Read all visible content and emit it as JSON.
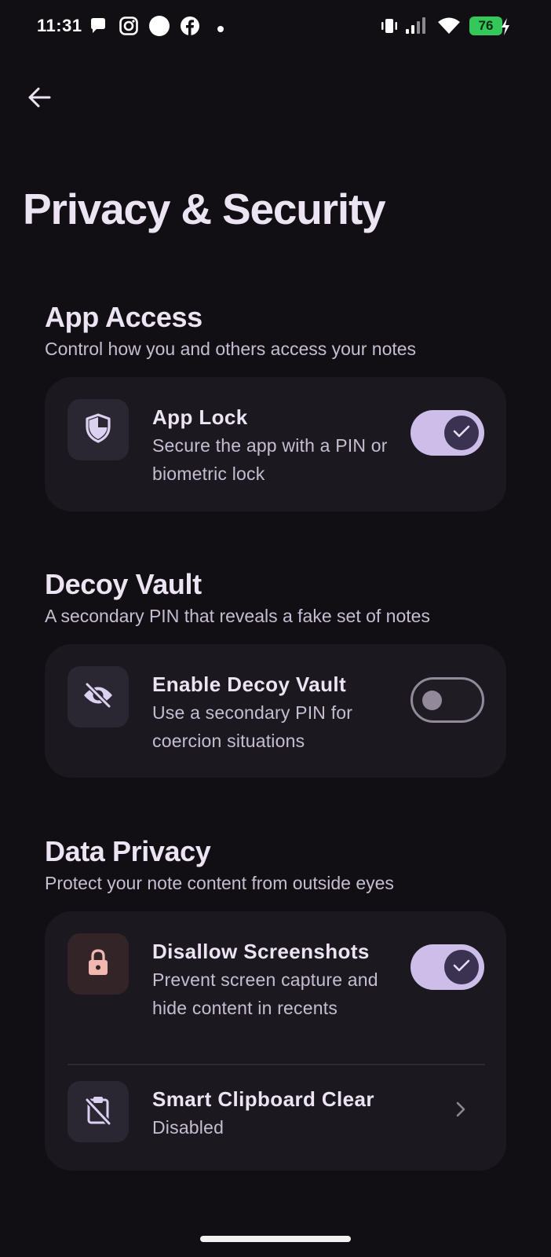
{
  "status_bar": {
    "time": "11:31",
    "battery_level": "76",
    "left_icons": [
      "chat-bubble-icon",
      "instagram-icon",
      "white-circle-icon",
      "facebook-icon",
      "dot-icon"
    ],
    "right_icons": [
      "vibrate-icon",
      "signal-icon",
      "wifi-icon",
      "battery-icon",
      "charging-bolt-icon"
    ]
  },
  "header": {
    "back_icon": "arrow-left-icon",
    "title": "Privacy & Security"
  },
  "sections": [
    {
      "title": "App Access",
      "subtitle": "Control how you and others access your notes",
      "rows": [
        {
          "icon": "shield-icon",
          "title": "App Lock",
          "description": "Secure the app with a PIN or biometric lock",
          "control": "toggle",
          "enabled": true
        }
      ]
    },
    {
      "title": "Decoy Vault",
      "subtitle": "A secondary PIN that reveals a fake set of notes",
      "rows": [
        {
          "icon": "eye-off-icon",
          "title": "Enable Decoy Vault",
          "description": "Use a secondary PIN for coercion situations",
          "control": "toggle",
          "enabled": false
        }
      ]
    },
    {
      "title": "Data Privacy",
      "subtitle": "Protect your note content from outside eyes",
      "rows": [
        {
          "icon": "lock-icon",
          "title": "Disallow Screenshots",
          "description": "Prevent screen capture and hide content in recents",
          "control": "toggle",
          "enabled": true
        },
        {
          "icon": "clipboard-off-icon",
          "title": "Smart Clipboard Clear",
          "description": "Disabled",
          "control": "chevron"
        }
      ]
    }
  ],
  "colors": {
    "background": "#110e14",
    "card": "#1b1820",
    "accent": "#ccbde9",
    "accent_dark": "#3a3250",
    "battery": "#34c759",
    "lock_icon": "#f1b8b2"
  }
}
